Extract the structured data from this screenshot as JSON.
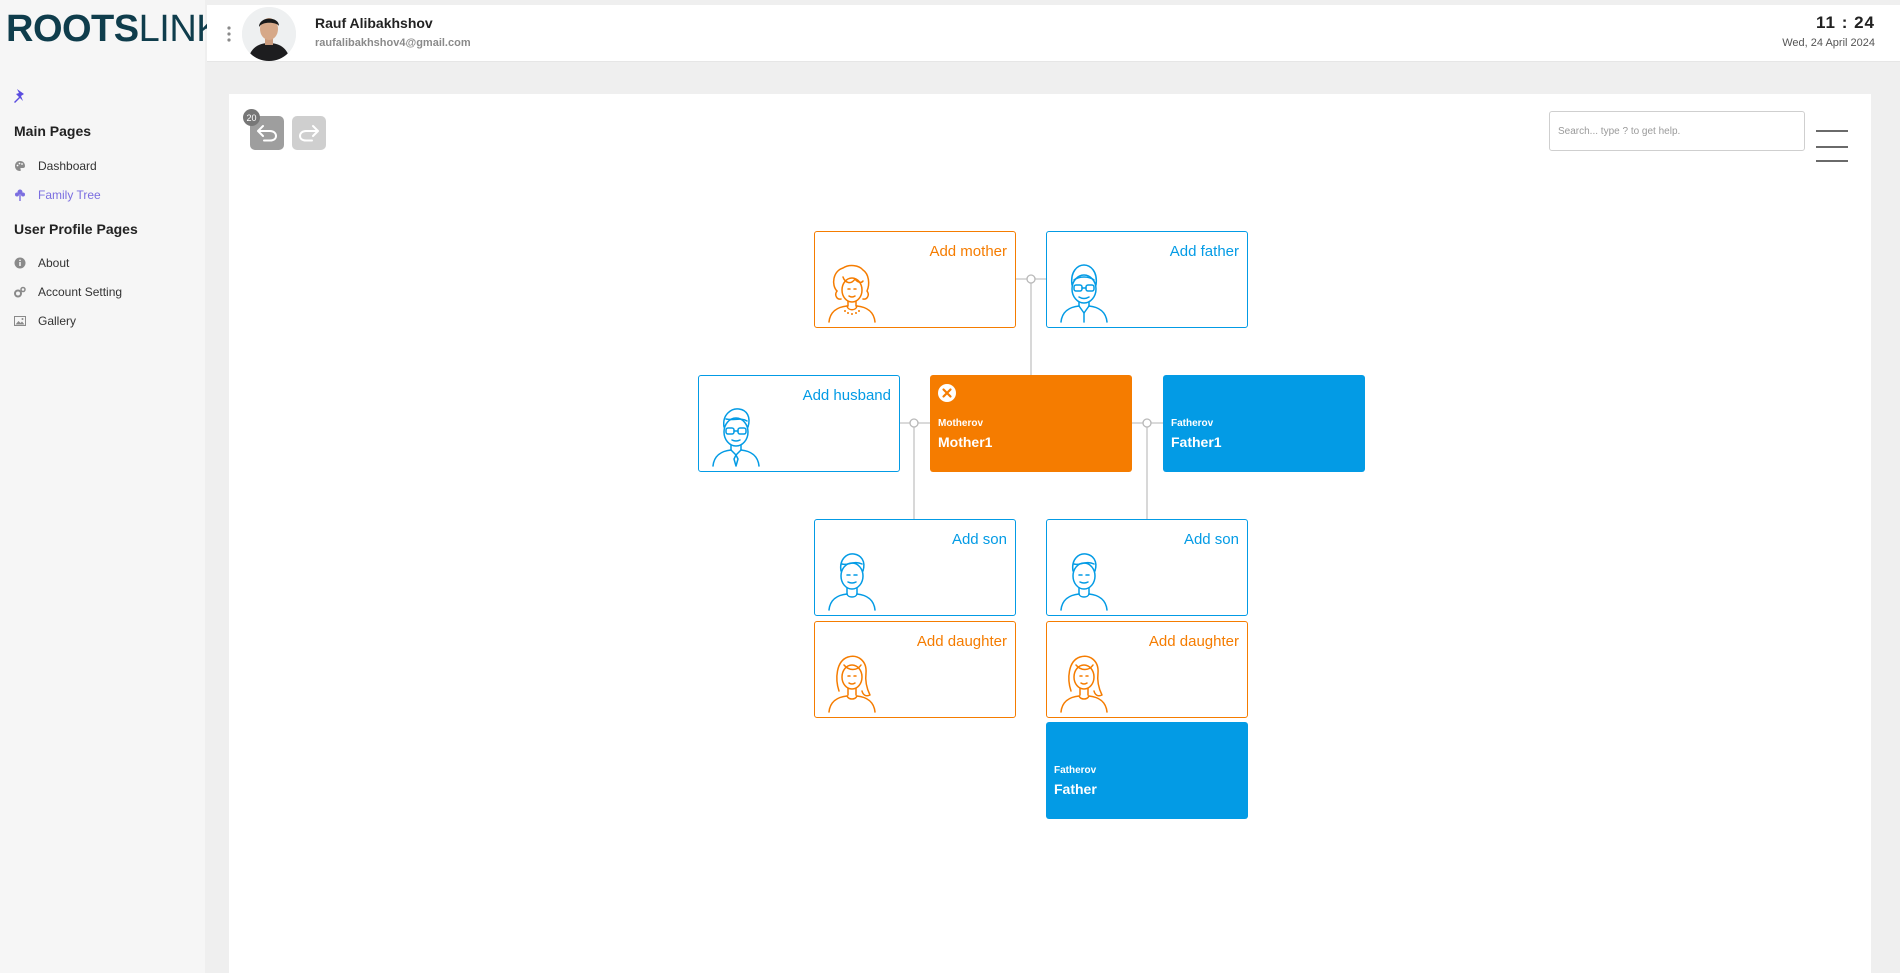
{
  "brand": {
    "bold": "ROOTS",
    "thin": "LINK"
  },
  "sidebar": {
    "sections": [
      {
        "title": "Main Pages",
        "items": [
          {
            "label": "Dashboard",
            "icon": "palette-icon",
            "active": false
          },
          {
            "label": "Family Tree",
            "icon": "tree-icon",
            "active": true
          }
        ]
      },
      {
        "title": "User Profile Pages",
        "items": [
          {
            "label": "About",
            "icon": "info-icon",
            "active": false
          },
          {
            "label": "Account Setting",
            "icon": "gears-icon",
            "active": false
          },
          {
            "label": "Gallery",
            "icon": "image-icon",
            "active": false
          }
        ]
      }
    ]
  },
  "header": {
    "user_name": "Rauf Alibakhshov",
    "user_email": "raufalibakhshov4@gmail.com",
    "time": "11 : 24",
    "date": "Wed, 24 April 2024"
  },
  "toolbar": {
    "undo_count": "20",
    "search_placeholder": "Search... type ? to get help."
  },
  "tree": {
    "add_mother": "Add mother",
    "add_father": "Add father",
    "add_husband": "Add husband",
    "add_son_1": "Add son",
    "add_son_2": "Add son",
    "add_daughter_1": "Add daughter",
    "add_daughter_2": "Add daughter",
    "selected_person": {
      "surname": "Motherov",
      "given": "Mother1"
    },
    "spouse_person": {
      "surname": "Fatherov",
      "given": "Father1"
    },
    "child_person": {
      "surname": "Fatherov",
      "given": "Father"
    }
  },
  "colors": {
    "female": "#f57c00",
    "male": "#039be5",
    "brand": "#0f3d4c",
    "active_nav": "#7b6ee0"
  }
}
